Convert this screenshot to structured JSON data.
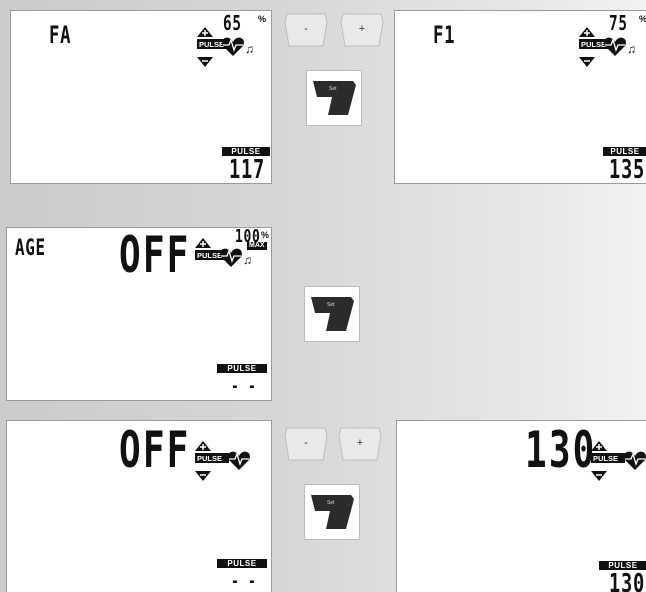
{
  "common": {
    "pulse_label": "PULSE",
    "percent_symbol": "%",
    "max_label": "MAX",
    "minus_label": "-",
    "plus_label": "+",
    "set_label": "Set"
  },
  "panel_a": {
    "mode_text": "FA",
    "percent_value": "65",
    "pulse_value": "117"
  },
  "panel_b": {
    "mode_text": "F1",
    "percent_value": "75",
    "pulse_value": "135"
  },
  "panel_c": {
    "mode_text": "AGE",
    "main_value": "OFF",
    "percent_value": "100",
    "pulse_value": "- -"
  },
  "panel_d": {
    "main_value": "OFF",
    "pulse_value": "- -"
  },
  "panel_e": {
    "main_value": "130",
    "pulse_value": "130"
  }
}
